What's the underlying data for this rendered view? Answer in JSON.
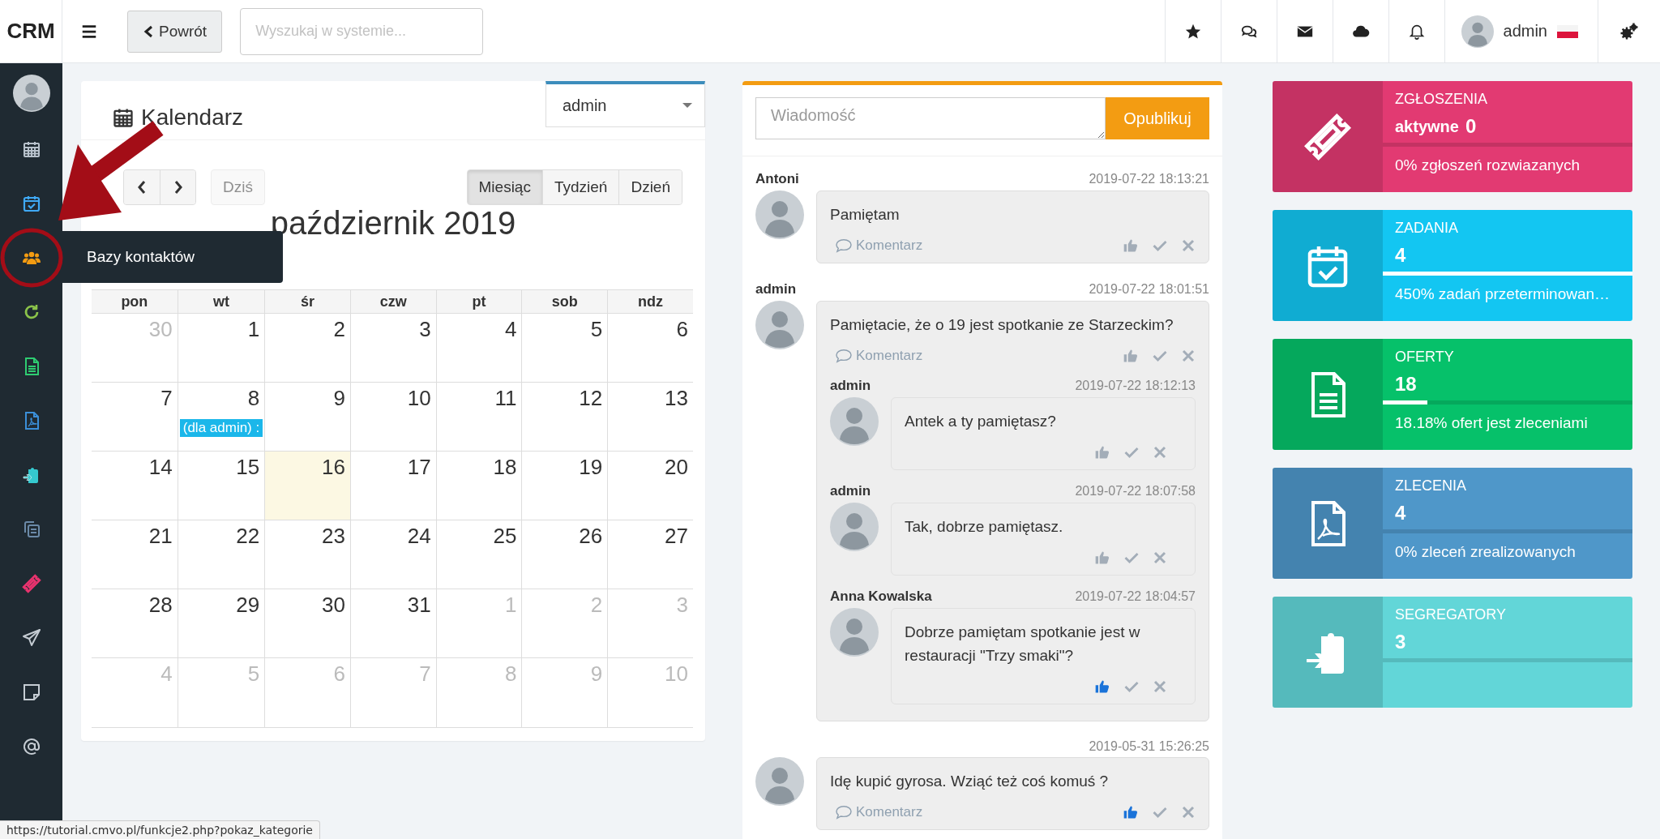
{
  "topbar": {
    "logo": "CRM",
    "back_label": "Powrót",
    "search": {
      "placeholder": "Wyszukaj w systemie..."
    },
    "user": "admin"
  },
  "sidebar": {
    "items": [
      {
        "color": "#b8c2cc"
      },
      {
        "color": "#3fa9f5"
      },
      {
        "color": "#f39c12",
        "tooltip": "Bazy kontaktów"
      },
      {
        "color": "#8bc34a"
      },
      {
        "color": "#2ecc71"
      },
      {
        "color": "#3b8fd9"
      },
      {
        "color": "#35c9cf"
      },
      {
        "color": "#6b8aa8"
      },
      {
        "color": "#e8336e"
      },
      {
        "color": "#c5ccd3"
      },
      {
        "color": "#c5ccd3"
      },
      {
        "color": "#c5ccd3"
      }
    ]
  },
  "calendar": {
    "title": "Kalendarz",
    "user_select": "admin",
    "today_label": "Dziś",
    "today_disabled": true,
    "views": [
      {
        "label": "Miesiąc",
        "selected": true
      },
      {
        "label": "Tydzień",
        "selected": false
      },
      {
        "label": "Dzień",
        "selected": false
      }
    ],
    "month": "październik 2019",
    "weekdays": [
      "pon",
      "wt",
      "śr",
      "czw",
      "pt",
      "sob",
      "ndz"
    ],
    "weeks": [
      {
        "days": [
          {
            "day": "30",
            "muted": true,
            "today": false
          },
          {
            "day": "1",
            "muted": false,
            "today": false
          },
          {
            "day": "2",
            "muted": false,
            "today": false
          },
          {
            "day": "3",
            "muted": false,
            "today": false
          },
          {
            "day": "4",
            "muted": false,
            "today": false
          },
          {
            "day": "5",
            "muted": false,
            "today": false
          },
          {
            "day": "6",
            "muted": false,
            "today": false
          }
        ]
      },
      {
        "days": [
          {
            "day": "7",
            "muted": false,
            "today": false
          },
          {
            "day": "8",
            "muted": false,
            "today": false,
            "events": [
              "(dla admin) :"
            ]
          },
          {
            "day": "9",
            "muted": false,
            "today": false
          },
          {
            "day": "10",
            "muted": false,
            "today": false
          },
          {
            "day": "11",
            "muted": false,
            "today": false
          },
          {
            "day": "12",
            "muted": false,
            "today": false
          },
          {
            "day": "13",
            "muted": false,
            "today": false
          }
        ]
      },
      {
        "days": [
          {
            "day": "14",
            "muted": false,
            "today": false
          },
          {
            "day": "15",
            "muted": false,
            "today": false
          },
          {
            "day": "16",
            "muted": false,
            "today": true
          },
          {
            "day": "17",
            "muted": false,
            "today": false
          },
          {
            "day": "18",
            "muted": false,
            "today": false
          },
          {
            "day": "19",
            "muted": false,
            "today": false
          },
          {
            "day": "20",
            "muted": false,
            "today": false
          }
        ]
      },
      {
        "days": [
          {
            "day": "21",
            "muted": false,
            "today": false
          },
          {
            "day": "22",
            "muted": false,
            "today": false
          },
          {
            "day": "23",
            "muted": false,
            "today": false
          },
          {
            "day": "24",
            "muted": false,
            "today": false
          },
          {
            "day": "25",
            "muted": false,
            "today": false
          },
          {
            "day": "26",
            "muted": false,
            "today": false
          },
          {
            "day": "27",
            "muted": false,
            "today": false
          }
        ]
      },
      {
        "days": [
          {
            "day": "28",
            "muted": false,
            "today": false
          },
          {
            "day": "29",
            "muted": false,
            "today": false
          },
          {
            "day": "30",
            "muted": false,
            "today": false
          },
          {
            "day": "31",
            "muted": false,
            "today": false
          },
          {
            "day": "1",
            "muted": true,
            "today": false
          },
          {
            "day": "2",
            "muted": true,
            "today": false
          },
          {
            "day": "3",
            "muted": true,
            "today": false
          }
        ]
      },
      {
        "days": [
          {
            "day": "4",
            "muted": true,
            "today": false
          },
          {
            "day": "5",
            "muted": true,
            "today": false
          },
          {
            "day": "6",
            "muted": true,
            "today": false
          },
          {
            "day": "7",
            "muted": true,
            "today": false
          },
          {
            "day": "8",
            "muted": true,
            "today": false
          },
          {
            "day": "9",
            "muted": true,
            "today": false
          },
          {
            "day": "10",
            "muted": true,
            "today": false
          }
        ]
      }
    ]
  },
  "feed": {
    "message": {
      "placeholder": "Wiadomość"
    },
    "publish_label": "Opublikuj",
    "posts": [
      {
        "author": "Antoni",
        "time": "2019-07-22 18:13:21",
        "text": "Pamiętam",
        "comment_label": "Komentarz",
        "liked": false
      },
      {
        "author": "admin",
        "time": "2019-07-22 18:01:51",
        "text": "Pamiętacie, że o 19 jest spotkanie ze Starzeckim?",
        "comment_label": "Komentarz",
        "liked": false,
        "replies": [
          {
            "author": "admin",
            "time": "2019-07-22 18:12:13",
            "text": "Antek a ty pamiętasz?",
            "liked": false
          },
          {
            "author": "admin",
            "time": "2019-07-22 18:07:58",
            "text": "Tak, dobrze pamiętasz.",
            "liked": false
          },
          {
            "author": "Anna Kowalska",
            "time": "2019-07-22 18:04:57",
            "text": "Dobrze pamiętam spotkanie jest w restauracji \"Trzy smaki\"?",
            "liked": true
          }
        ]
      },
      {
        "time": "2019-05-31 15:26:25",
        "text": "Idę kupić gyrosa. Wziąć też coś komuś ?",
        "comment_label": "Komentarz",
        "liked": true
      }
    ]
  },
  "stat_cards": [
    {
      "title": "ZGŁOSZENIA",
      "value_label": "aktywne",
      "value": "0",
      "level": 0,
      "footer": "0% zgłoszeń rozwiazanych",
      "color": "#e23a72"
    },
    {
      "title": "ZADANIA",
      "value": "4",
      "level": 1,
      "footer": "450% zadań przeterminowan…",
      "color": "#13c6f2"
    },
    {
      "title": "OFERTY",
      "value": "18",
      "level": 0.18,
      "footer": "18.18% ofert jest zleceniami",
      "color": "#06c16a"
    },
    {
      "title": "ZLECENIA",
      "value": "4",
      "level": 0,
      "footer": "0% zleceń zrealizowanych",
      "color": "#4f97c9"
    },
    {
      "title": "SEGREGATORY",
      "value": "3",
      "level": 0,
      "color": "#62d6d8"
    }
  ],
  "status_url": "https://tutorial.cmvo.pl/funkcje2.php?pokaz_kategorie"
}
